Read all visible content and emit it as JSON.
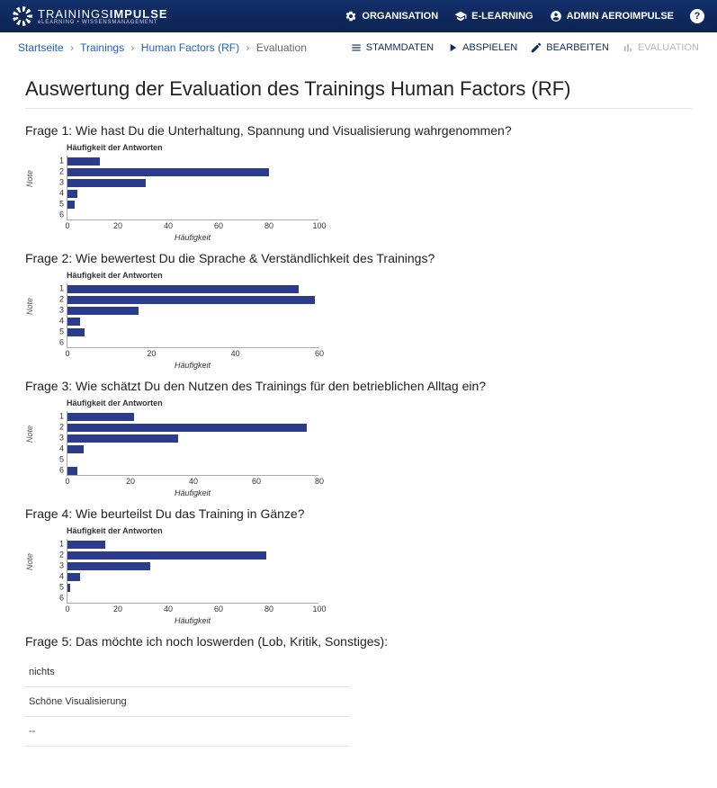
{
  "header": {
    "logo_main": "TRAININGS",
    "logo_bold": "IMPULSE",
    "logo_sub": "eLEARNING • WISSENSMANAGEMENT",
    "nav": {
      "organisation": "ORGANISATION",
      "elearning": "E-LEARNING",
      "admin": "ADMIN AEROIMPULSE",
      "help": "?"
    }
  },
  "breadcrumb": {
    "start": "Startseite",
    "trainings": "Trainings",
    "hf": "Human Factors (RF)",
    "current": "Evaluation"
  },
  "tabs": {
    "stammdaten": "STAMMDATEN",
    "abspielen": "ABSPIELEN",
    "bearbeiten": "BEARBEITEN",
    "evaluation": "EVALUATION"
  },
  "title": "Auswertung der Evaluation des Trainings Human Factors (RF)",
  "charts_common": {
    "title": "Häufigkeit der Antworten",
    "ylabel": "Note",
    "xlabel": "Häufigkeit"
  },
  "questions": {
    "q1": "Frage 1: Wie hast Du die Unterhaltung, Spannung und Visualisierung wahrgenommen?",
    "q2": "Frage 2: Wie bewertest Du die Sprache & Verständlichkeit des Trainings?",
    "q3": "Frage 3: Wie schätzt Du den Nutzen des Trainings für den betrieblichen Alltag ein?",
    "q4": "Frage 4: Wie beurteilst Du das Training in Gänze?",
    "q5": "Frage 5: Das möchte ich noch loswerden (Lob, Kritik, Sonstiges):"
  },
  "responses": {
    "r1": "nichts",
    "r2": "Schöne Visualisierung",
    "r3": "--"
  },
  "chart_data": [
    {
      "type": "bar",
      "orientation": "horizontal",
      "title": "Häufigkeit der Antworten",
      "ylabel": "Note",
      "xlabel": "Häufigkeit",
      "categories": [
        "1",
        "2",
        "3",
        "4",
        "5",
        "6"
      ],
      "values": [
        13,
        80,
        31,
        4,
        3,
        0
      ],
      "xticks": [
        0,
        20,
        40,
        60,
        80,
        100
      ],
      "xmax": 100
    },
    {
      "type": "bar",
      "orientation": "horizontal",
      "title": "Häufigkeit der Antworten",
      "ylabel": "Note",
      "xlabel": "Häufigkeit",
      "categories": [
        "1",
        "2",
        "3",
        "4",
        "5",
        "6"
      ],
      "values": [
        55,
        59,
        17,
        3,
        4,
        0
      ],
      "xticks": [
        0,
        20,
        40,
        60
      ],
      "xmax": 60
    },
    {
      "type": "bar",
      "orientation": "horizontal",
      "title": "Häufigkeit der Antworten",
      "ylabel": "Note",
      "xlabel": "Häufigkeit",
      "categories": [
        "1",
        "2",
        "3",
        "4",
        "5",
        "6"
      ],
      "values": [
        21,
        76,
        35,
        5,
        0,
        3
      ],
      "xticks": [
        0,
        20,
        40,
        60,
        80
      ],
      "xmax": 80
    },
    {
      "type": "bar",
      "orientation": "horizontal",
      "title": "Häufigkeit der Antworten",
      "ylabel": "Note",
      "xlabel": "Häufigkeit",
      "categories": [
        "1",
        "2",
        "3",
        "4",
        "5",
        "6"
      ],
      "values": [
        15,
        79,
        33,
        5,
        1,
        0
      ],
      "xticks": [
        0,
        20,
        40,
        60,
        80,
        100
      ],
      "xmax": 100
    }
  ]
}
